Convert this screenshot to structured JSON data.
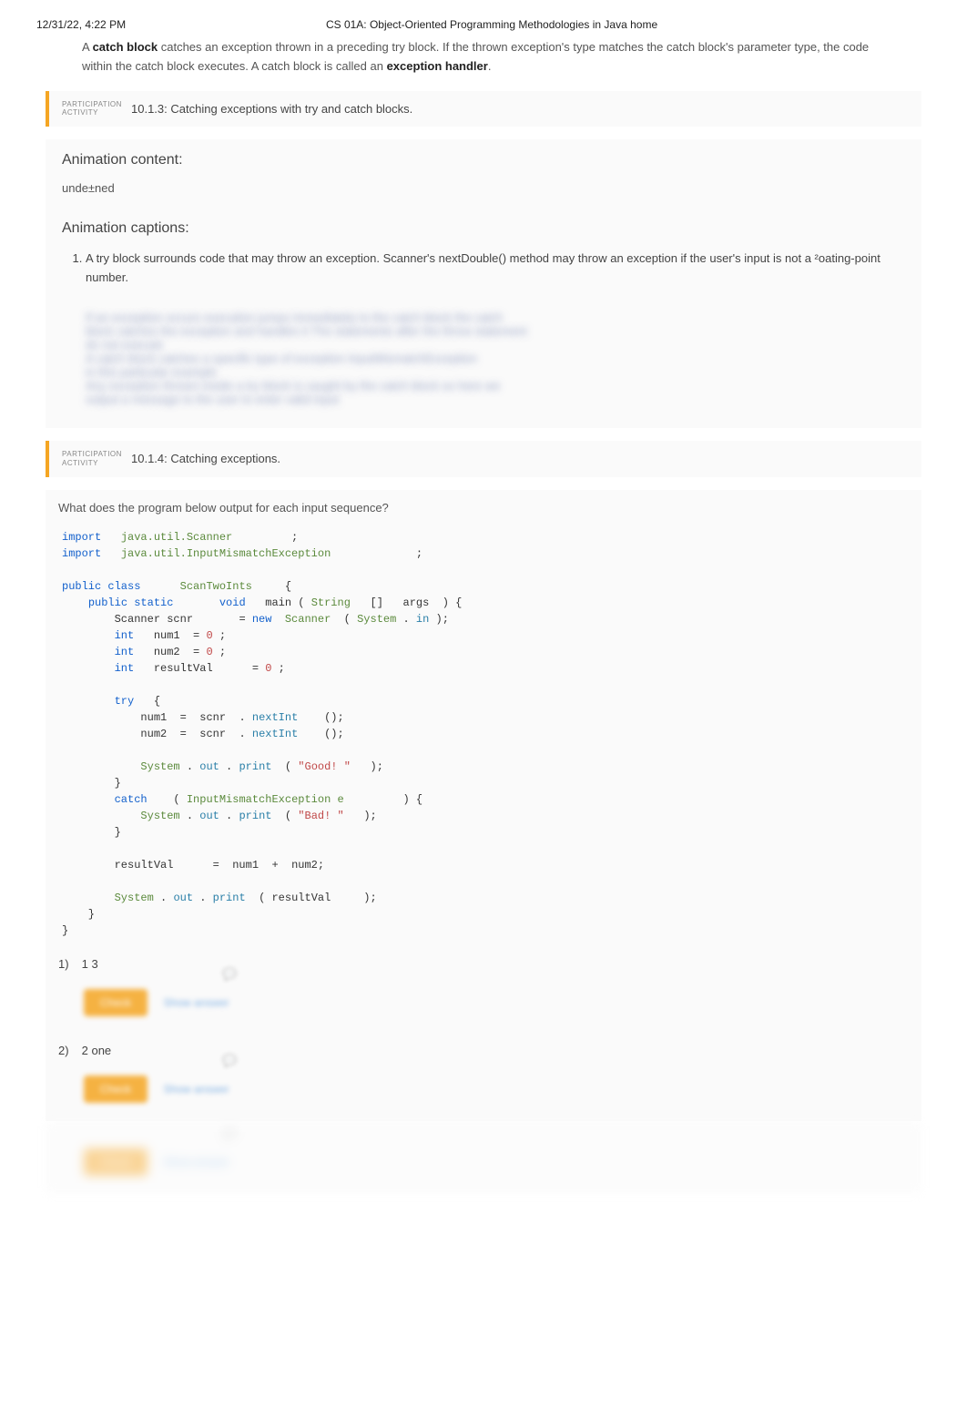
{
  "header": {
    "timestamp": "12/31/22, 4:22 PM",
    "title": "CS 01A: Object-Oriented Programming Methodologies in Java home"
  },
  "intro": {
    "prefix": "A ",
    "term1": "catch block",
    "mid": " catches an exception thrown in a preceding try block. If the thrown exception's type matches the catch block's parameter type, the code within the catch block executes. A catch block is called an ",
    "term2": "exception handler",
    "suffix": "."
  },
  "activity1": {
    "label1": "PARTICIPATION",
    "label2": "ACTIVITY",
    "title": "10.1.3: Catching exceptions with try and catch blocks."
  },
  "animation": {
    "content_heading": "Animation content:",
    "undefined": "unde±ned",
    "captions_heading": "Animation captions:",
    "captions": [
      "A try block surrounds code that may throw an exception. Scanner's nextDouble() method may throw an exception if the user's input is not a ²oating-point number."
    ],
    "blurred_lines": [
      "If an exception occurs execution jumps immediately to the catch block the catch",
      "block catches the exception and handles it The statements after the throw statement",
      "do not execute",
      "A catch block catches a specific type of exception InputMismatchException",
      "in this particular example",
      "Any exception thrown inside a try block is caught by the catch block so here we",
      "output a message to the user to enter valid input"
    ]
  },
  "activity2": {
    "label1": "PARTICIPATION",
    "label2": "ACTIVITY",
    "title": "10.1.4: Catching exceptions."
  },
  "question": {
    "text": "What does the program below output for each input sequence?"
  },
  "code": {
    "import1a": "import",
    "import1b": "java.util.Scanner",
    "import2a": "import",
    "import2b": "java.util.InputMismatchException",
    "public_class": "public class",
    "class_name": "ScanTwoInts",
    "public_static": "public static",
    "void": "void",
    "main": "main",
    "string": "String",
    "args": "args",
    "scanner_decl_a": "Scanner scnr",
    "new": "new",
    "scanner": "Scanner",
    "system": "System",
    "in": "in",
    "int": "int",
    "num1": "num1",
    "zero": "0",
    "num2": "num2",
    "resultVal": "resultVal",
    "try": "try",
    "num1_assign": "num1",
    "scnr": "scnr",
    "nextInt": "nextInt",
    "num2_assign": "num2",
    "out": "out",
    "print": "print",
    "good": "\"Good! \"",
    "catch": "catch",
    "exception_type": "InputMismatchException e",
    "bad": "\"Bad! \"",
    "plus": "+"
  },
  "q1": {
    "num": "1)",
    "input": "1 3"
  },
  "q2": {
    "num": "2)",
    "input": "2 one"
  },
  "buttons": {
    "check": "Check",
    "show": "Show answer"
  }
}
